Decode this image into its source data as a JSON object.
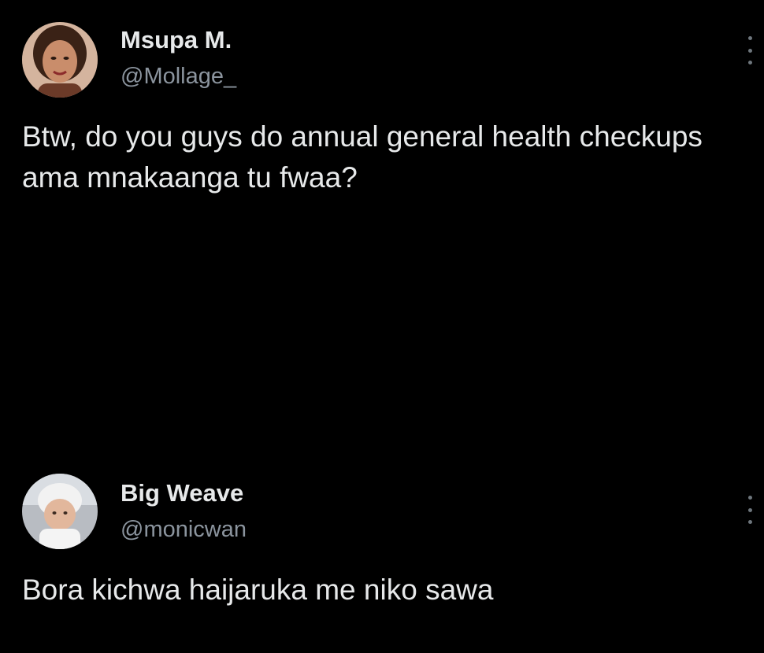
{
  "tweets": [
    {
      "display_name": "Msupa M.",
      "handle": "@Mollage_",
      "text": "Btw, do you guys do annual general health checkups ama mnakaanga tu fwaa?",
      "avatar_icon": "profile-photo-woman",
      "more_icon": "more-vertical-icon"
    },
    {
      "display_name": "Big Weave",
      "handle": "@monicwan",
      "text": "Bora kichwa haijaruka me niko sawa",
      "avatar_icon": "profile-photo-baby",
      "more_icon": "more-vertical-icon"
    }
  ],
  "colors": {
    "background": "#000000",
    "primary_text": "#e7e9ea",
    "secondary_text": "#8b949e"
  }
}
